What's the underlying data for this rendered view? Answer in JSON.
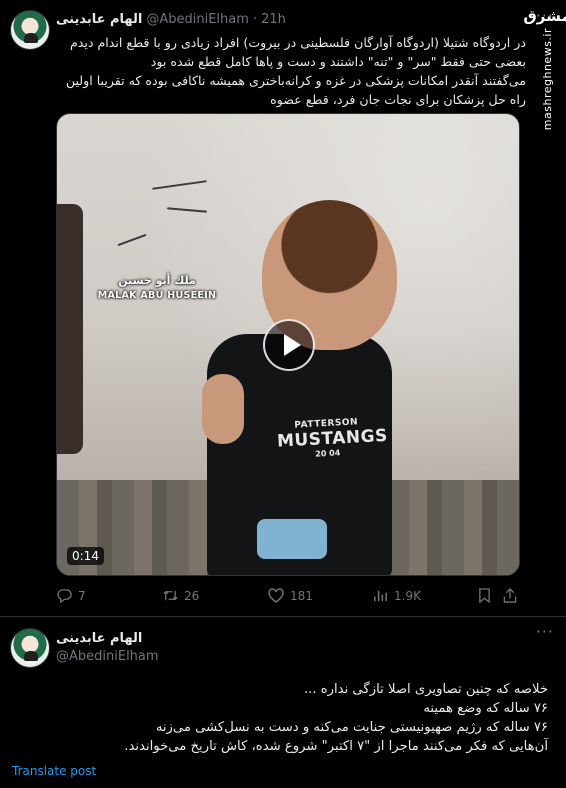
{
  "tweet1": {
    "display_name": "الهام عابدینی",
    "handle": "@AbediniElham",
    "separator": "·",
    "time": "21h",
    "text_lines": [
      "در اردوگاه شتیلا (اردوگاه آوارگان فلسطینی در بیروت) افراد زیادی رو با قطع اندام دیدم",
      "بعضی حتی فقط \"سر\" و \"تنه\" داشتند و دست و پاها کامل قطع شده بود",
      "می‌گفتند آنقدر امکانات پزشکی در غزه و کرانه‌باختری همیشه ناکافی بوده که تقریبا اولین",
      "راه حل پزشکان برای نجات جان فرد، قطع عضوه"
    ],
    "media": {
      "caption_arabic": "ملك أبو حسين",
      "caption_english": "MALAK ABU HUSEEIN",
      "shirt_line1": "PATTERSON",
      "shirt_line2": "MUSTANGS",
      "shirt_line3": "20 04",
      "duration": "0:14"
    },
    "actions": {
      "replies": "7",
      "retweets": "26",
      "likes": "181",
      "views": "1.9K"
    }
  },
  "watermark": {
    "logo": "مشرق",
    "url": "mashreghnews.ir"
  },
  "tweet2": {
    "display_name": "الهام عابدینی",
    "handle": "@AbediniElham",
    "text_lines": [
      "خلاصه که چنین تصاویری اصلا تازگی نداره ...",
      "۷۶ ساله که وضع همینه",
      "۷۶ ساله که رژیم صهیونیستی جنایت می‌کنه و دست به نسل‌کشی می‌زنه",
      "آن‌هایی که فکر می‌کنند ماجرا از \"۷ اکتبر\" شروع شده، کاش تاریخ می‌خواندند."
    ],
    "translate_label": "Translate post"
  },
  "icons": {
    "more": "more-icon",
    "reply": "reply-icon",
    "retweet": "retweet-icon",
    "like": "like-icon",
    "views": "views-icon",
    "bookmark": "bookmark-icon",
    "share": "share-icon",
    "play": "play-icon"
  }
}
